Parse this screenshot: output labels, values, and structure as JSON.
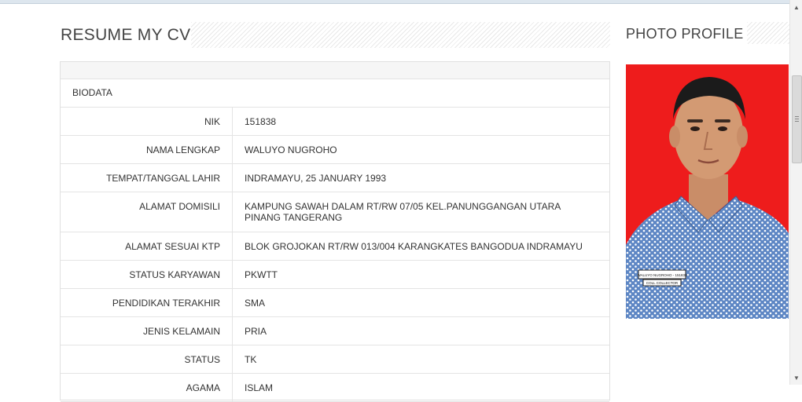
{
  "resume": {
    "title": "RESUME MY CV",
    "section_label": "BIODATA",
    "rows": [
      {
        "label": "NIK",
        "value": "151838"
      },
      {
        "label": "NAMA LENGKAP",
        "value": "WALUYO NUGROHO"
      },
      {
        "label": "TEMPAT/TANGGAL LAHIR",
        "value": "INDRAMAYU, 25 JANUARY 1993"
      },
      {
        "label": "ALAMAT DOMISILI",
        "value": "KAMPUNG SAWAH DALAM RT/RW 07/05 KEL.PANUNGGANGAN UTARA PINANG TANGERANG"
      },
      {
        "label": "ALAMAT SESUAI KTP",
        "value": "BLOK GROJOKAN RT/RW 013/004 KARANGKATES BANGODUA INDRAMAYU"
      },
      {
        "label": "STATUS KARYAWAN",
        "value": "PKWTT"
      },
      {
        "label": "PENDIDIKAN TERAKHIR",
        "value": "SMA"
      },
      {
        "label": "JENIS KELAMAIN",
        "value": "PRIA"
      },
      {
        "label": "STATUS",
        "value": "TK"
      },
      {
        "label": "AGAMA",
        "value": "ISLAM"
      }
    ]
  },
  "photo": {
    "title": "PHOTO PROFILE",
    "badge_text": "WALUYO NUGROHO - 151838",
    "badge_role": "COLL COLLECTOR"
  },
  "colors": {
    "photo_background": "#ee1c1c",
    "shirt": "#5d86c4",
    "table_border": "#e4e4e4"
  }
}
